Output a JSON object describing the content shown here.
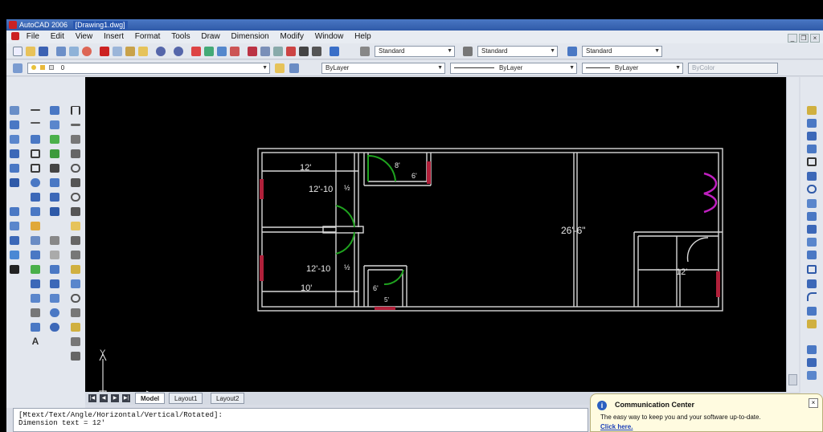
{
  "window": {
    "app_name": "AutoCAD 2006",
    "document": "[Drawing1.dwg]"
  },
  "menu": [
    "File",
    "Edit",
    "View",
    "Insert",
    "Format",
    "Tools",
    "Draw",
    "Dimension",
    "Modify",
    "Window",
    "Help"
  ],
  "styles": {
    "text_style": "Standard",
    "dim_style": "Standard",
    "table_style": "Standard"
  },
  "layers": {
    "current_layer": "0",
    "color": "ByLayer",
    "linetype": "ByLayer",
    "lineweight": "ByLayer",
    "plot_style": "ByColor"
  },
  "drawing": {
    "labels": {
      "room_top_width": "12'",
      "room_top_size": "12'-10",
      "room_bottom_size": "12'-10",
      "room_bottom_width": "10'",
      "small_room_top": "8'",
      "small_room_top_b": "6'",
      "hall_length": "26'-6\"",
      "right_room": "12'",
      "small_room_bottom": "6'",
      "small_room_bottom_b": "5'",
      "half_mark": "½",
      "half_mark_b": "½"
    },
    "ucs": {
      "x": "X",
      "y": "Y"
    }
  },
  "tabs": [
    "Model",
    "Layout1",
    "Layout2"
  ],
  "command_line": {
    "line1": "[Mtext/Text/Angle/Horizontal/Vertical/Rotated]:",
    "line2": "Dimension text = 12'"
  },
  "communication_center": {
    "title": "Communication Center",
    "body": "The easy way to keep you and your software up-to-date.",
    "link": "Click here."
  },
  "colors": {
    "wall": "#d8d8d8",
    "door_green": "#1fa31f",
    "window_red": "#b0203a",
    "door_magenta": "#c020c0",
    "canvas": "#000000"
  }
}
